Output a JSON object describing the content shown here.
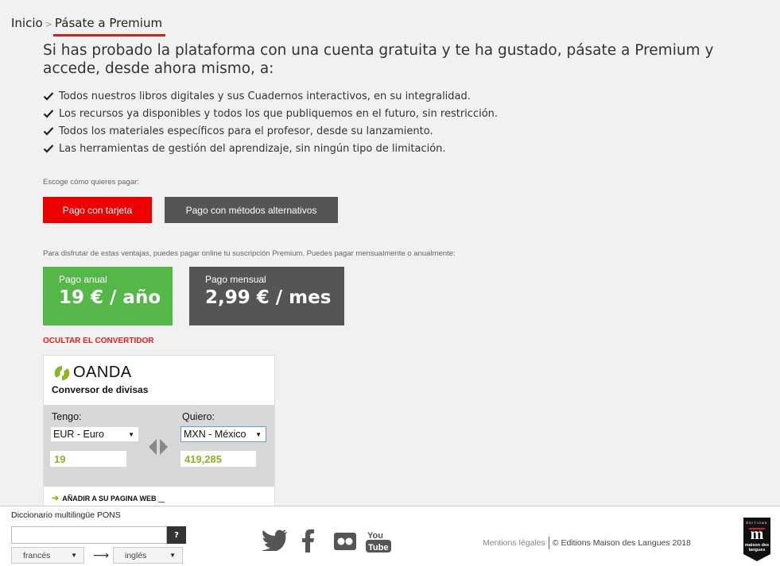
{
  "breadcrumb": {
    "home": "Inicio",
    "separator": ">",
    "current": "Pásate a Premium"
  },
  "headline": "Si has probado la plataforma con una cuenta gratuita y te ha gustado, pásate a Premium y accede, desde ahora mismo, a:",
  "benefits": [
    "Todos nuestros libros digitales y sus Cuadernos interactivos, en su integralidad.",
    "Los recursos ya disponibles y todos los que publiquemos en el futuro, sin restricción.",
    "Todos los materiales específicos para el profesor, desde su lanzamiento.",
    "Las herramientas de gestión del aprendizaje, sin ningún tipo de limitación."
  ],
  "payment": {
    "choose_label": "Escoge cómo quieres pagar:",
    "card_button": "Pago con tarjeta",
    "alt_button": "Pago con métodos alternativos",
    "subscription_text": "Para disfrutar de estas ventajas, puedes pagar online tu suscripción Premium. Puedes pagar mensualmente o anualmente:"
  },
  "plans": {
    "annual": {
      "name": "Pago anual",
      "price": "19 € / año",
      "color": "#55b748"
    },
    "monthly": {
      "name": "Pago mensual",
      "price": "2,99 € / mes",
      "color": "#555555"
    }
  },
  "converter": {
    "toggle_label": "OCULTAR EL CONVERTIDOR",
    "brand": "OANDA",
    "title": "Conversor de divisas",
    "from_label": "Tengo:",
    "to_label": "Quiero:",
    "from_currency": "EUR - Euro",
    "to_currency": "MXN - México",
    "from_amount": "19",
    "to_amount": "419,285",
    "add_link": "AÑADIR A SU PAGINA WEB"
  },
  "footer": {
    "dict_title": "Diccionario multilingüe PONS",
    "dict_input_value": "",
    "dict_button": "?",
    "source_lang": "francés",
    "target_lang": "inglés",
    "lang_arrow": "⟶",
    "social_icons": [
      "twitter-icon",
      "facebook-icon",
      "flickr-icon",
      "youtube-icon"
    ],
    "legal_link": "Mentions légales",
    "copyright": "© Editions Maison des Langues 2018",
    "badge_text": "maison des langues"
  },
  "colors": {
    "accent_red": "#ee0000",
    "green": "#55b748",
    "dark": "#555555"
  }
}
